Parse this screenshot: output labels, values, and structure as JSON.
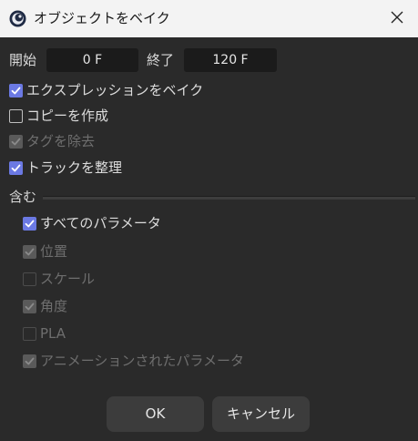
{
  "window": {
    "title": "オブジェクトをベイク",
    "app_icon": "cinema4d-logo-icon",
    "close_icon": "close-icon"
  },
  "range": {
    "start_label": "開始",
    "start_value": "0 F",
    "end_label": "終了",
    "end_value": "120 F"
  },
  "options": [
    {
      "label": "エクスプレッションをベイク",
      "checked": true,
      "disabled": false
    },
    {
      "label": "コピーを作成",
      "checked": false,
      "disabled": false
    },
    {
      "label": "タグを除去",
      "checked": true,
      "disabled": true
    },
    {
      "label": "トラックを整理",
      "checked": true,
      "disabled": false
    }
  ],
  "include": {
    "heading": "含む",
    "items": [
      {
        "label": "すべてのパラメータ",
        "checked": true,
        "disabled": false
      },
      {
        "label": "位置",
        "checked": true,
        "disabled": true
      },
      {
        "label": "スケール",
        "checked": false,
        "disabled": true
      },
      {
        "label": "角度",
        "checked": true,
        "disabled": true
      },
      {
        "label": "PLA",
        "checked": false,
        "disabled": true
      },
      {
        "label": "アニメーションされたパラメータ",
        "checked": true,
        "disabled": true
      }
    ]
  },
  "buttons": {
    "ok_label": "OK",
    "cancel_label": "キャンセル"
  },
  "colors": {
    "checkbox_accent": "#6b79e3",
    "dialog_background": "#2a2a2a",
    "titlebar_background": "#f3f3f3"
  }
}
